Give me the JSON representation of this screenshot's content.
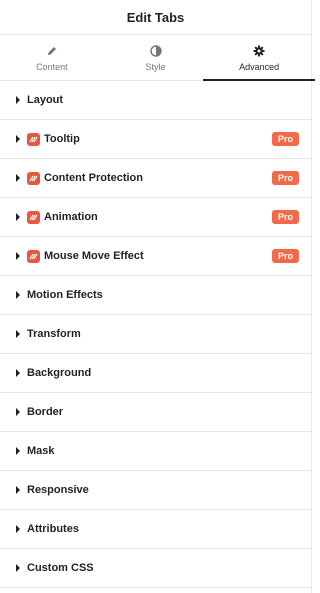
{
  "header": {
    "title": "Edit Tabs"
  },
  "tabs": [
    {
      "label": "Content",
      "icon": "pencil-icon",
      "active": false
    },
    {
      "label": "Style",
      "icon": "half-circle-icon",
      "active": false
    },
    {
      "label": "Advanced",
      "icon": "gear-icon",
      "active": true
    }
  ],
  "sections": [
    {
      "label": "Layout",
      "pro": false,
      "badge": ""
    },
    {
      "label": "Tooltip",
      "pro": true,
      "badge": "Pro"
    },
    {
      "label": "Content Protection",
      "pro": true,
      "badge": "Pro"
    },
    {
      "label": "Animation",
      "pro": true,
      "badge": "Pro"
    },
    {
      "label": "Mouse Move Effect",
      "pro": true,
      "badge": "Pro"
    },
    {
      "label": "Motion Effects",
      "pro": false,
      "badge": ""
    },
    {
      "label": "Transform",
      "pro": false,
      "badge": ""
    },
    {
      "label": "Background",
      "pro": false,
      "badge": ""
    },
    {
      "label": "Border",
      "pro": false,
      "badge": ""
    },
    {
      "label": "Mask",
      "pro": false,
      "badge": ""
    },
    {
      "label": "Responsive",
      "pro": false,
      "badge": ""
    },
    {
      "label": "Attributes",
      "pro": false,
      "badge": ""
    },
    {
      "label": "Custom CSS",
      "pro": false,
      "badge": ""
    }
  ],
  "colors": {
    "badge": "#f26a4b",
    "pro_icon": "#e8573f",
    "text": "#1f2124"
  }
}
